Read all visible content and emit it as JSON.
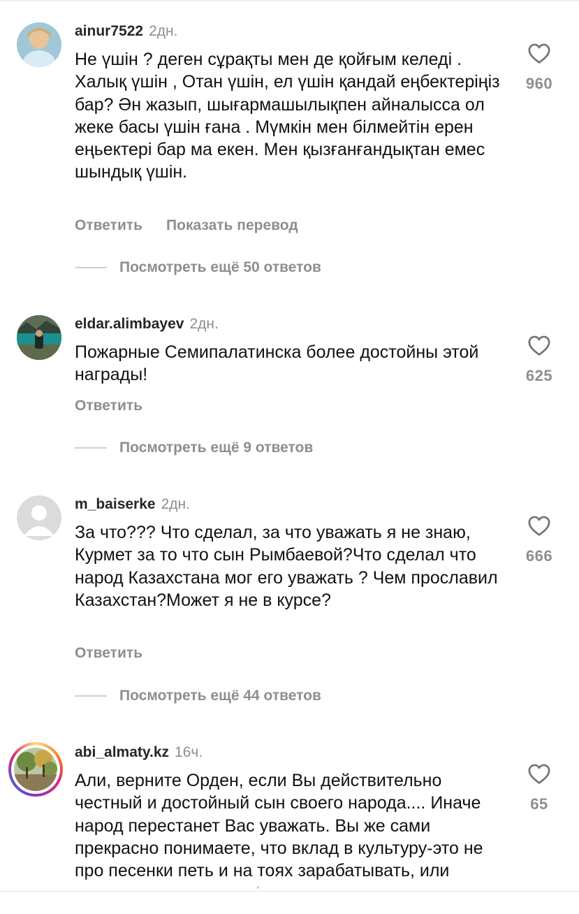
{
  "comments": [
    {
      "username": "ainur7522",
      "time": "2дн.",
      "text": "Не үшін ? деген сұрақты мен де қойғым келеді . Халық үшін , Отан үшін, ел үшін қандай еңбектеріңіз бар? Ән жазып, шығармашылықпен айналысса ол жеке басы үшін ғана . Мүмкін мен білмейтін ерен еңьектері бар ма екен. Мен қызғанғандықтан емес шындық үшін.",
      "reply_label": "Ответить",
      "translate_label": "Показать перевод",
      "view_replies": "Посмотреть ещё 50 ответов",
      "likes": "960",
      "avatar": "avatar-photo-woman"
    },
    {
      "username": "eldar.alimbayev",
      "time": "2дн.",
      "text": "Пожарные Семипалатинска более достойны этой награды!",
      "reply_label": "Ответить",
      "view_replies": "Посмотреть ещё 9 ответов",
      "likes": "625",
      "avatar": "avatar-photo-lake"
    },
    {
      "username": "m_baiserke",
      "time": "2дн.",
      "text": "За что??? Что сделал, за что уважать я не знаю, Курмет за то что сын Рымбаевой?Что сделал что народ Казахстана мог его уважать ? Чем прославил Казахстан?Может я не в курсе?",
      "reply_label": "Ответить",
      "view_replies": "Посмотреть ещё 44 ответов",
      "likes": "666",
      "avatar": "default-avatar-icon"
    },
    {
      "username": "abi_almaty.kz",
      "time": "16ч.",
      "text": "Али, верните Орден, если Вы действительно честный и достойный сын своего народа.... Иначе народ перестанет Вас уважать. Вы же сами прекрасно понимаете, что вклад в культуру-это не про песенки петь и на тоях зарабатывать, или пользоваться связями!",
      "likes": "65",
      "avatar": "avatar-photo-trees-story"
    }
  ],
  "colors": {
    "secondary_text": "#8e8e8e",
    "username": "#262626",
    "divider": "#d0d0d0"
  },
  "icons": {
    "like": "heart-outline-icon"
  }
}
